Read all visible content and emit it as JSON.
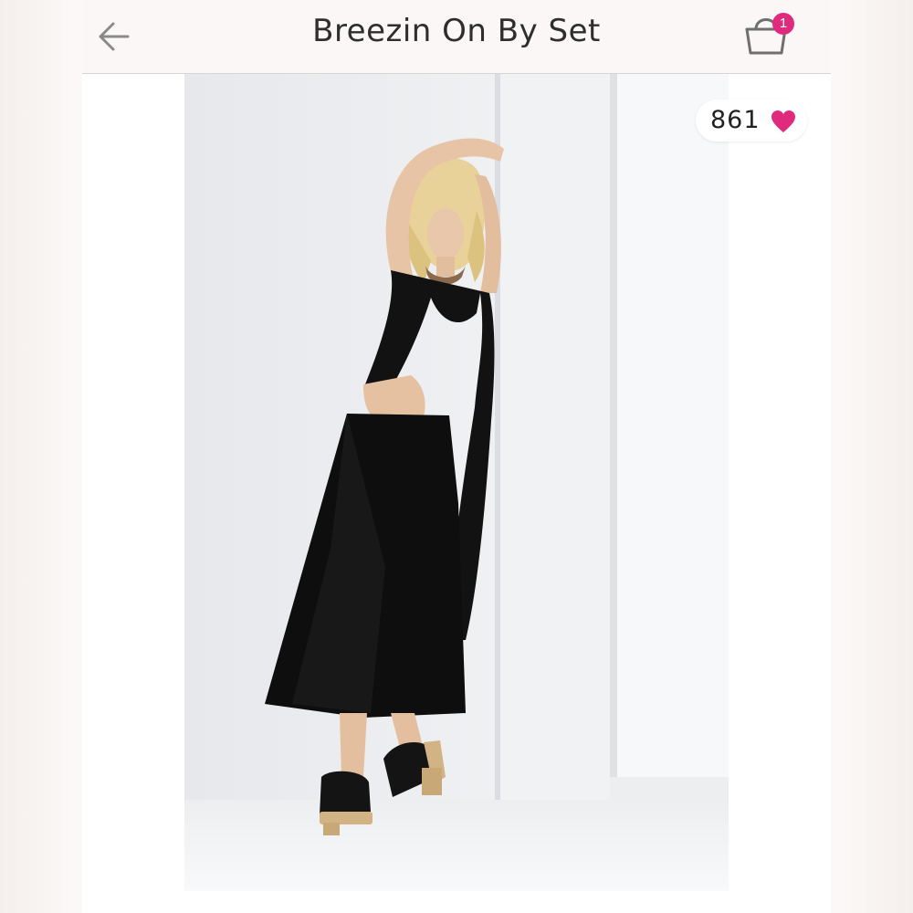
{
  "header": {
    "title": "Breezin On By Set",
    "back_icon": "arrow-left-icon",
    "cart_icon": "shopping-bag-icon",
    "cart_count": "1"
  },
  "listing": {
    "likes_count": "861",
    "likes_icon": "heart-icon",
    "photo": {
      "description_icon": "product-photo",
      "garment_color": "#111111"
    }
  },
  "colors": {
    "accent": "#e02a7e",
    "title_text": "#2e2e2e",
    "header_bg": "#faf7f6"
  }
}
